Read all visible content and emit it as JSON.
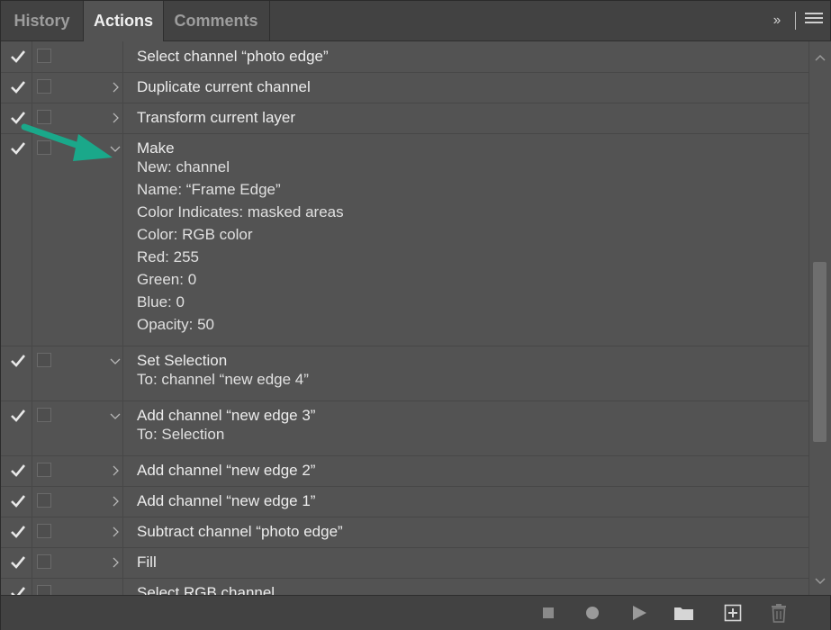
{
  "tabs": [
    {
      "label": "History",
      "active": false
    },
    {
      "label": "Actions",
      "active": true
    },
    {
      "label": "Comments",
      "active": false
    }
  ],
  "collapse_glyph": "››",
  "icons": {
    "checkmark": "check-icon",
    "dialog": "dialog-toggle-icon",
    "expanded": "chevron-down-icon",
    "collapsed": "chevron-right-icon"
  },
  "actions": [
    {
      "label": "Select channel “photo edge”",
      "toggle": "none",
      "details": []
    },
    {
      "label": "Duplicate current channel",
      "toggle": "collapsed",
      "details": []
    },
    {
      "label": "Transform current layer",
      "toggle": "collapsed",
      "details": []
    },
    {
      "label": "Make",
      "toggle": "expanded",
      "details": [
        "New: channel",
        "Name:  “Frame Edge”",
        "Color Indicates: masked areas",
        "Color: RGB color",
        "Red: 255",
        "Green: 0",
        "Blue: 0",
        "Opacity: 50"
      ]
    },
    {
      "label": "Set Selection",
      "toggle": "expanded",
      "details": [
        "To: channel “new edge 4”"
      ]
    },
    {
      "label": "Add channel “new edge 3”",
      "toggle": "expanded",
      "details": [
        "To: Selection"
      ]
    },
    {
      "label": "Add channel “new edge 2”",
      "toggle": "collapsed",
      "details": []
    },
    {
      "label": "Add channel “new edge 1”",
      "toggle": "collapsed",
      "details": []
    },
    {
      "label": "Subtract channel “photo edge”",
      "toggle": "collapsed",
      "details": []
    },
    {
      "label": "Fill",
      "toggle": "collapsed",
      "details": []
    },
    {
      "label": "Select RGB channel",
      "toggle": "none",
      "details": []
    }
  ],
  "bottom_buttons": [
    {
      "name": "stop-button",
      "icon": "stop-icon"
    },
    {
      "name": "record-button",
      "icon": "record-icon"
    },
    {
      "name": "play-button",
      "icon": "play-icon"
    },
    {
      "name": "new-set-button",
      "icon": "folder-icon"
    },
    {
      "name": "new-action-button",
      "icon": "add-icon"
    },
    {
      "name": "delete-button",
      "icon": "trash-icon"
    }
  ],
  "colors": {
    "panel_bg": "#535353",
    "tab_bar_bg": "#424242",
    "text": "#ececec",
    "annotation_arrow": "#1aa88a"
  }
}
